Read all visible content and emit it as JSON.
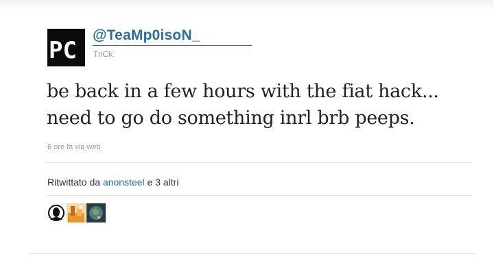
{
  "tweet": {
    "handle": "@TeaMp0isoN_",
    "display_name": "TriCk",
    "avatar_text": "PC",
    "text_line1": "be back in a few hours with the fiat hack...",
    "text_line2": "need to go do something inrl brb peeps.",
    "meta": "6 ore fa via web"
  },
  "retweets": {
    "prefix": "Ritwittato da",
    "user": "anonsteel",
    "suffix": "e 3 altri",
    "avatars": [
      "anonymous-mask-avatar",
      "orange-photo-avatar",
      "globe-avatar"
    ]
  },
  "colors": {
    "link": "#2a6f9c",
    "text": "#222222",
    "muted": "#9a9a9a"
  }
}
